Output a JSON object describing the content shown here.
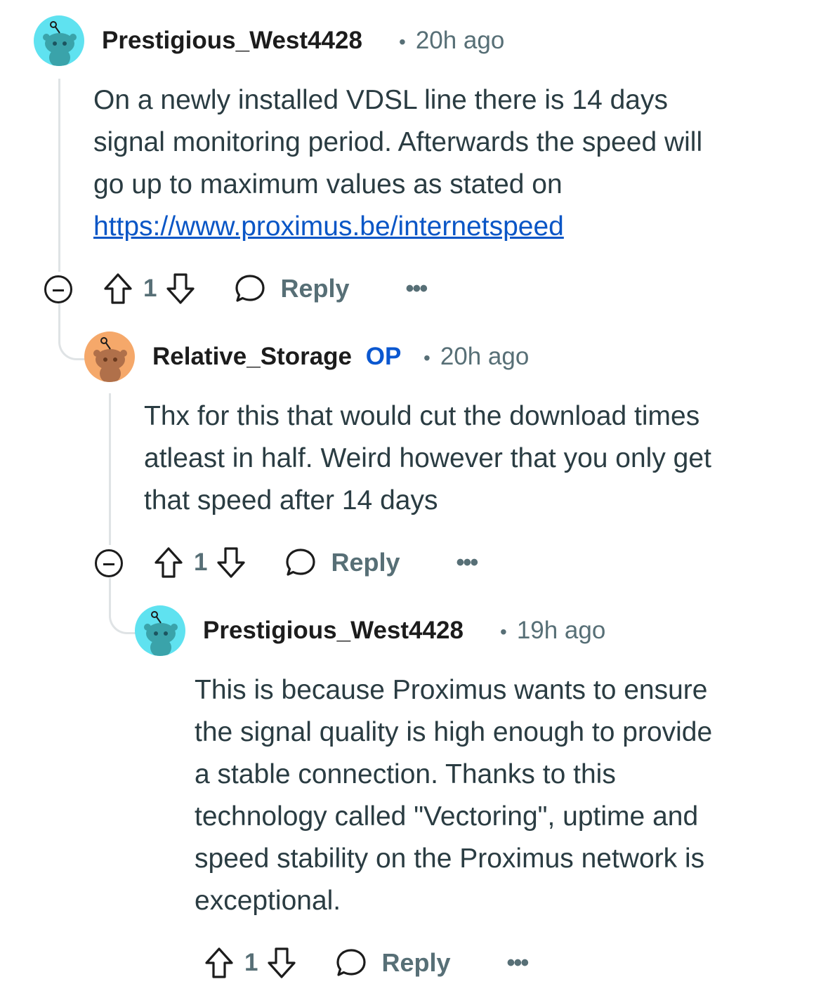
{
  "comments": [
    {
      "username": "Prestigious_West4428",
      "op_badge": "",
      "time": "20h ago",
      "avatar_color": "#5fe2f0",
      "body_lines": [
        "On a newly installed VDSL line there is 14 days",
        "signal monitoring period. Afterwards the speed will",
        "go up to maximum values as stated on"
      ],
      "link": "https://www.proximus.be/internetspeed",
      "score": "1",
      "reply_label": "Reply",
      "more_label": "•••",
      "icons": [
        "collapse-icon",
        "upvote-icon",
        "downvote-icon",
        "reply-bubble-icon",
        "more-icon"
      ]
    },
    {
      "username": "Relative_Storage",
      "op_badge": "OP",
      "time": "20h ago",
      "avatar_color": "#f5a86a",
      "body_lines": [
        "Thx for this that would cut the download times",
        "atleast in half. Weird however that you only get",
        "that speed after 14 days"
      ],
      "score": "1",
      "reply_label": "Reply",
      "more_label": "•••"
    },
    {
      "username": "Prestigious_West4428",
      "op_badge": "",
      "time": "19h ago",
      "avatar_color": "#5fe2f0",
      "body_lines": [
        "This is because Proximus wants to ensure",
        "the signal quality is high enough to provide",
        "a stable connection. Thanks to this",
        "technology called \"Vectoring\", uptime and",
        "speed stability on the Proximus network is",
        "exceptional."
      ],
      "score": "1",
      "reply_label": "Reply",
      "more_label": "•••"
    }
  ],
  "separator": "•"
}
